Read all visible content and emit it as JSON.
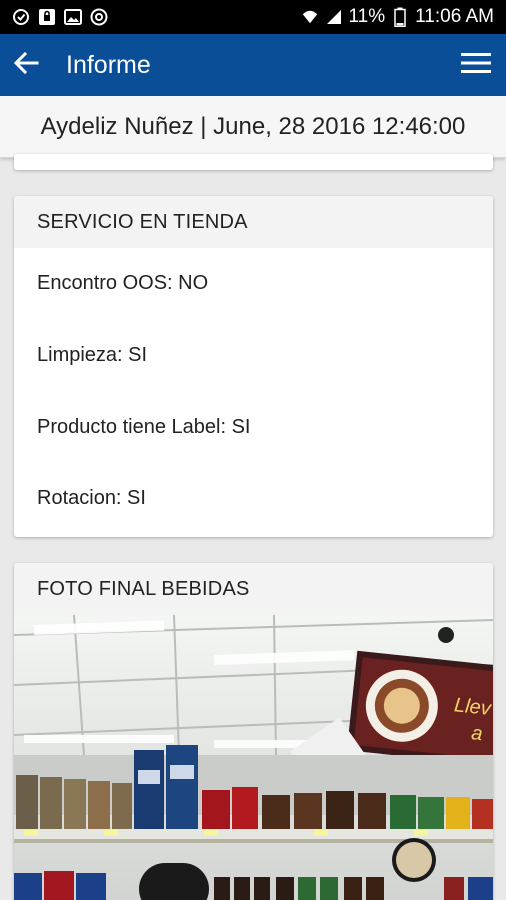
{
  "status_bar": {
    "battery": "11%",
    "time": "11:06 AM"
  },
  "app_bar": {
    "title": "Informe"
  },
  "sub_header": {
    "text": "Aydeliz Nuñez | June, 28 2016 12:46:00"
  },
  "service_card": {
    "title": "SERVICIO EN TIENDA",
    "rows": [
      "Encontro OOS: NO",
      "Limpieza: SI",
      "Producto tiene Label: SI",
      "Rotacion: SI"
    ]
  },
  "photo_card": {
    "title": "FOTO FINAL BEBIDAS",
    "sign_text": "Llev",
    "sign_text_2": "a"
  },
  "icons": [
    "wifi-icon",
    "signal-icon",
    "battery-icon",
    "back-arrow-icon",
    "hamburger-menu-icon"
  ]
}
